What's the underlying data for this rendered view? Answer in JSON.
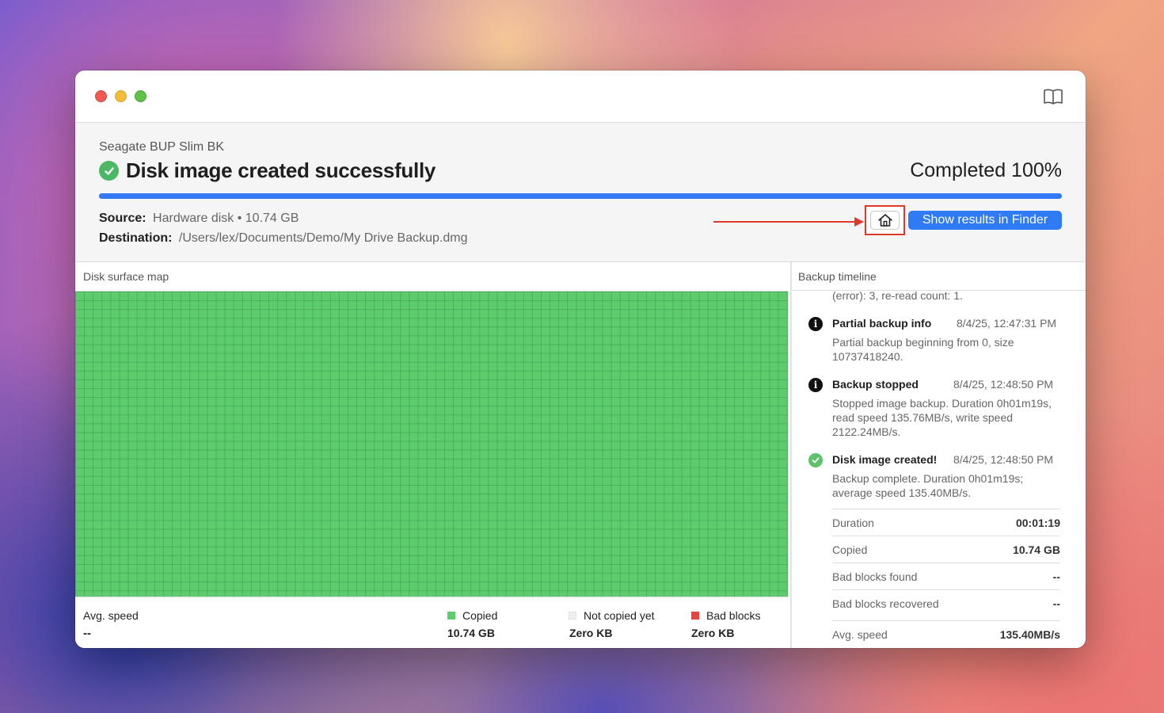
{
  "header": {
    "device_name": "Seagate BUP Slim BK",
    "status_title": "Disk image created successfully",
    "completed_text": "Completed 100%",
    "progress_percent": 100,
    "source_label": "Source:",
    "source_value": "Hardware disk • 10.74 GB",
    "destination_label": "Destination:",
    "destination_value": "/Users/lex/Documents/Demo/My Drive Backup.dmg",
    "finder_button": "Show results in Finder"
  },
  "icons": {
    "home_button_icon": "home-icon",
    "toolbar_icon": "book-icon",
    "status_icon": "check-circle-icon"
  },
  "colors": {
    "accent": "#3478f6",
    "copied": "#5ccc6d",
    "not_copied": "#f0f0f0",
    "bad_blocks": "#e5453b",
    "annotation": "#e0392b"
  },
  "surface_map": {
    "label": "Disk surface map",
    "avg_speed_label": "Avg. speed",
    "avg_speed_value": "--",
    "legend": [
      {
        "label": "Copied",
        "value": "10.74 GB"
      },
      {
        "label": "Not copied yet",
        "value": "Zero KB"
      },
      {
        "label": "Bad blocks",
        "value": "Zero KB"
      }
    ]
  },
  "timeline": {
    "label": "Backup timeline",
    "clipped_text": "(error): 3, re-read count: 1.",
    "events": [
      {
        "title": "Partial backup info",
        "time": "8/4/25, 12:47:31 PM",
        "text": "Partial backup beginning from 0, size 10737418240."
      },
      {
        "title": "Backup stopped",
        "time": "8/4/25, 12:48:50 PM",
        "text": "Stopped image backup. Duration 0h01m19s, read speed 135.76MB/s, write speed 2122.24MB/s."
      },
      {
        "title": "Disk image created!",
        "time": "8/4/25, 12:48:50 PM",
        "text": "Backup complete. Duration 0h01m19s; average speed 135.40MB/s."
      }
    ],
    "stats": [
      {
        "key": "Duration",
        "value": "00:01:19"
      },
      {
        "key": "Copied",
        "value": "10.74 GB"
      },
      {
        "key": "Bad blocks found",
        "value": "--"
      },
      {
        "key": "Bad blocks recovered",
        "value": "--"
      },
      {
        "key": "Avg. speed",
        "value": "135.40MB/s"
      }
    ]
  }
}
